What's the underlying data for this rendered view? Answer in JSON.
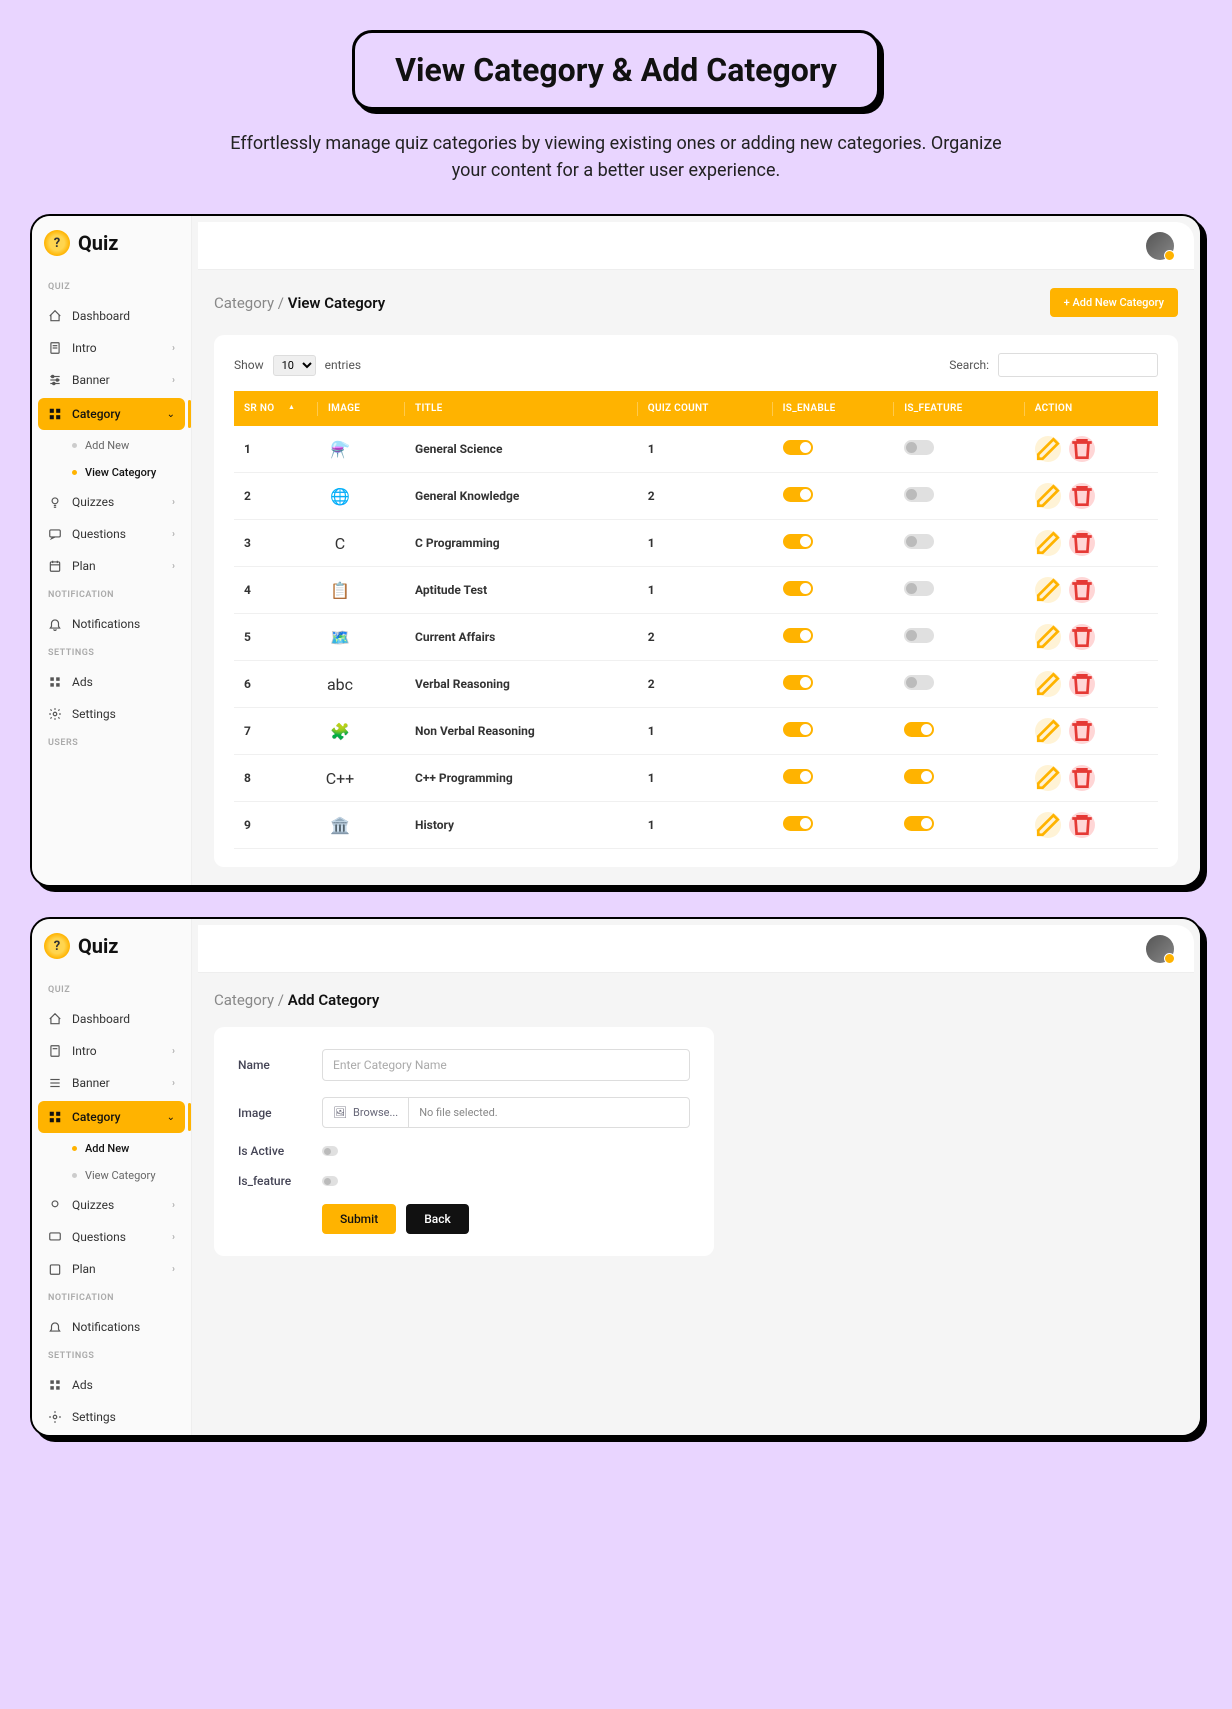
{
  "page_title": "View Category & Add Category",
  "page_subtitle": "Effortlessly manage quiz categories by viewing existing ones or adding new categories. Organize your content for a better user experience.",
  "app_name": "Quiz",
  "sidebar": {
    "sections": {
      "quiz": "QUIZ",
      "notification": "NOTIFICATION",
      "settings": "SETTINGS",
      "users": "USERS"
    },
    "items": {
      "dashboard": "Dashboard",
      "intro": "Intro",
      "banner": "Banner",
      "category": "Category",
      "add_new": "Add New",
      "view_category": "View Category",
      "quizzes": "Quizzes",
      "questions": "Questions",
      "plan": "Plan",
      "notifications": "Notifications",
      "ads": "Ads",
      "settings_item": "Settings"
    }
  },
  "view1": {
    "breadcrumb_parent": "Category / ",
    "breadcrumb_current": "View Category",
    "add_btn": "+ Add New Category",
    "show_label": "Show",
    "entries_label": "entries",
    "entries_value": "10",
    "search_label": "Search:",
    "columns": {
      "sr": "SR NO",
      "image": "IMAGE",
      "title": "TITLE",
      "count": "QUIZ COUNT",
      "enable": "IS_ENABLE",
      "feature": "IS_FEATURE",
      "action": "ACTION"
    },
    "rows": [
      {
        "sr": "1",
        "img": "⚗️",
        "title": "General Science",
        "count": "1",
        "enable": true,
        "feature": false
      },
      {
        "sr": "2",
        "img": "🌐",
        "title": "General Knowledge",
        "count": "2",
        "enable": true,
        "feature": false
      },
      {
        "sr": "3",
        "img": "C",
        "title": "C Programming",
        "count": "1",
        "enable": true,
        "feature": false
      },
      {
        "sr": "4",
        "img": "📋",
        "title": "Aptitude Test",
        "count": "1",
        "enable": true,
        "feature": false
      },
      {
        "sr": "5",
        "img": "🗺️",
        "title": "Current Affairs",
        "count": "2",
        "enable": true,
        "feature": false
      },
      {
        "sr": "6",
        "img": "abc",
        "title": "Verbal Reasoning",
        "count": "2",
        "enable": true,
        "feature": false
      },
      {
        "sr": "7",
        "img": "🧩",
        "title": "Non Verbal Reasoning",
        "count": "1",
        "enable": true,
        "feature": true
      },
      {
        "sr": "8",
        "img": "C++",
        "title": "C++ Programming",
        "count": "1",
        "enable": true,
        "feature": true
      },
      {
        "sr": "9",
        "img": "🏛️",
        "title": "History",
        "count": "1",
        "enable": true,
        "feature": true
      }
    ]
  },
  "view2": {
    "breadcrumb_parent": "Category / ",
    "breadcrumb_current": "Add Category",
    "labels": {
      "name": "Name",
      "image": "Image",
      "is_active": "Is Active",
      "is_feature": "Is_feature",
      "browse": "Browse...",
      "no_file": "No file selected.",
      "name_placeholder": "Enter Category Name",
      "submit": "Submit",
      "back": "Back"
    }
  }
}
